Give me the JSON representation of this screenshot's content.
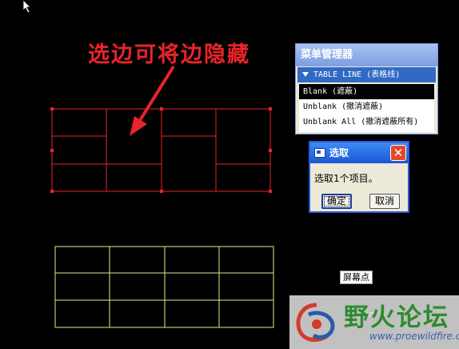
{
  "annotation": {
    "text": "选边可将边隐藏"
  },
  "menu_manager": {
    "title": "菜单管理器",
    "header": "TABLE LINE (表格线)",
    "items": [
      {
        "label": "Blank (遮蔽)",
        "selected": true
      },
      {
        "label": "Unblank (撤消遮蔽)",
        "selected": false
      },
      {
        "label": "Unblank All (撤消遮蔽所有)",
        "selected": false
      }
    ]
  },
  "dialog": {
    "title": "选取",
    "message": "选取1个项目。",
    "ok_label": "确定",
    "cancel_label": "取消",
    "close_label": "✕"
  },
  "screen_point": {
    "label": "屏幕点"
  },
  "watermark": {
    "name": "野火论坛",
    "url": "www.proewildfire.cn"
  },
  "colors": {
    "red_table": "#e8242a",
    "yellow_table": "#e8e888",
    "annotation": "#e8242a"
  }
}
